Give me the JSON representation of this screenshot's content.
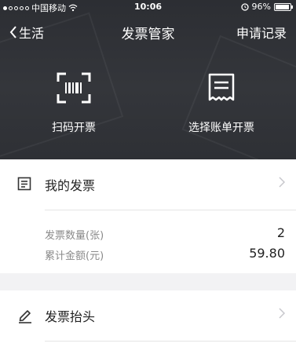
{
  "status_bar": {
    "carrier": "中国移动",
    "time": "10:06",
    "battery": "96%",
    "battery_level": 0.96
  },
  "nav": {
    "back_label": "生活",
    "title": "发票管家",
    "right_label": "申请记录"
  },
  "actions": {
    "scan_label": "扫码开票",
    "bill_label": "选择账单开票"
  },
  "my_invoices": {
    "label": "我的发票",
    "count_label": "发票数量(张)",
    "count_value": "2",
    "amount_label": "累计金额(元)",
    "amount_value": "59.80"
  },
  "invoice_header": {
    "label": "发票抬头"
  },
  "colors": {
    "header_bg": "#2f3136",
    "page_bg": "#f2f2f4"
  }
}
